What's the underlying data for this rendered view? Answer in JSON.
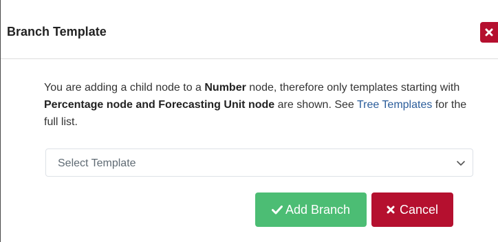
{
  "dialog": {
    "title": "Branch Template",
    "close_icon": "close-icon"
  },
  "message": {
    "part1": "You are adding a child node to a ",
    "node_type": "Number",
    "part2": " node, therefore only templates starting with ",
    "allowed_types": "Percentage node and Forecasting Unit node",
    "part3": " are shown. See ",
    "link_text": "Tree Templates",
    "part4": " for the full list."
  },
  "template_select": {
    "value": "Select Template",
    "icon": "chevron-down-icon"
  },
  "buttons": {
    "add_label": "Add Branch",
    "add_icon": "check-icon",
    "cancel_label": "Cancel",
    "cancel_icon": "times-icon"
  },
  "colors": {
    "add_button": "#4cbd74",
    "cancel_button": "#b5102f",
    "link": "#2a5c9a"
  }
}
